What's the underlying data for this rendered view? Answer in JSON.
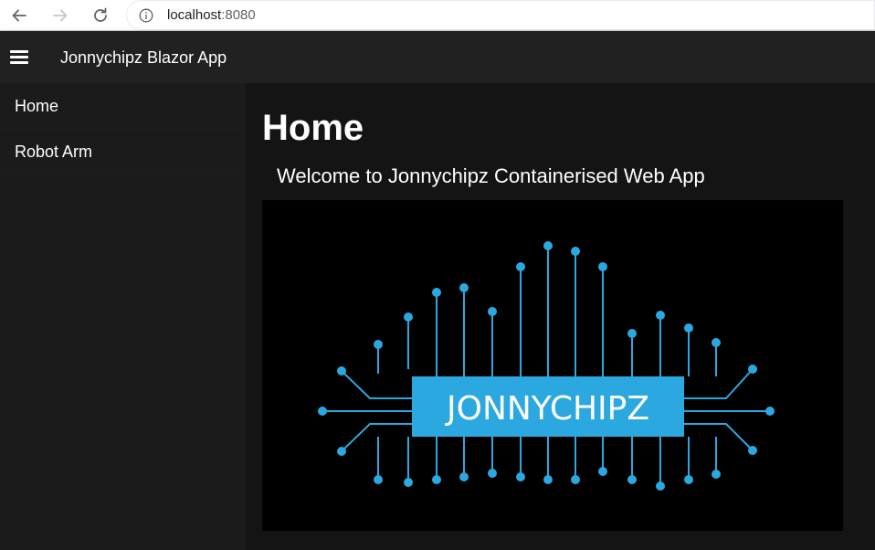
{
  "browser": {
    "url_host": "localhost",
    "url_port": ":8080"
  },
  "app": {
    "title": "Jonnychipz Blazor App"
  },
  "sidebar": {
    "items": [
      {
        "label": "Home"
      },
      {
        "label": "Robot Arm"
      }
    ]
  },
  "main": {
    "heading": "Home",
    "welcome": "Welcome to Jonnychipz Containerised Web App",
    "logo_text": "JONNYCHIPZ"
  },
  "colors": {
    "logo_accent": "#2ba8e0",
    "logo_text": "#ffffff"
  }
}
